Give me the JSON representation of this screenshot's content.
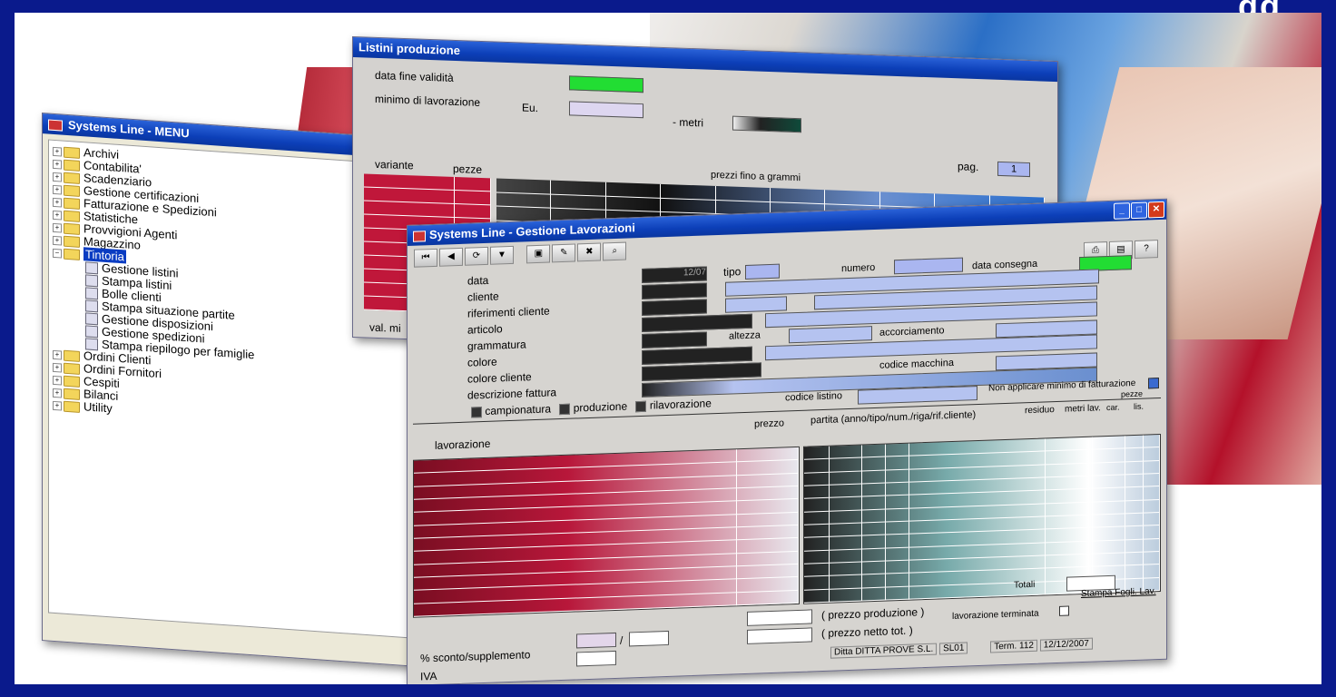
{
  "menu_window": {
    "title": "Systems Line - MENU",
    "items": [
      {
        "label": "Archivi",
        "expanded": false
      },
      {
        "label": "Contabilita'",
        "expanded": false
      },
      {
        "label": "Scadenziario",
        "expanded": false
      },
      {
        "label": "Gestione certificazioni",
        "expanded": false
      },
      {
        "label": "Fatturazione e Spedizioni",
        "expanded": false
      },
      {
        "label": "Statistiche",
        "expanded": false
      },
      {
        "label": "Provvigioni Agenti",
        "expanded": false
      },
      {
        "label": "Magazzino",
        "expanded": false
      },
      {
        "label": "Tintoria",
        "expanded": true,
        "selected": true
      }
    ],
    "sub_items": [
      "Gestione listini",
      "Stampa  listini",
      "Bolle   clienti",
      "Stampa   situazione partite",
      "Gestione disposizioni",
      "Gestione spedizioni",
      "Stampa   riepilogo per famiglie"
    ],
    "items_after": [
      "Ordini Clienti",
      "Ordini Fornitori",
      "Cespiti",
      "Bilanci",
      "Utility"
    ]
  },
  "listini_window": {
    "title": "Listini produzione",
    "data_fine_validita": "data fine validità",
    "minimo_lavorazione": "minimo di lavorazione",
    "eu_label": "Eu.",
    "metri_label": "- metri",
    "pag_label": "pag.",
    "pag_value": "1",
    "variante": "variante",
    "pezze": "pezze",
    "prezzi_header": "prezzi fino a grammi",
    "val_mi": "val. mi"
  },
  "gestione_window": {
    "title": "Systems Line - Gestione Lavorazioni",
    "fields": {
      "data": "data",
      "data_value": "12/07",
      "tipo": "tipo",
      "numero": "numero",
      "data_consegna": "data consegna",
      "cliente": "cliente",
      "riferimenti_cliente": "riferimenti cliente",
      "articolo": "articolo",
      "grammatura": "grammatura",
      "altezza": "altezza",
      "accorciamento": "accorciamento",
      "colore": "colore",
      "colore_cliente": "colore cliente",
      "codice_macchina": "codice macchina",
      "descrizione_fattura": "descrizione fattura"
    },
    "checks": {
      "campionatura": "campionatura",
      "produzione": "produzione",
      "rilavorazione": "rilavorazione",
      "codice_listino": "codice listino",
      "non_applicare": "Non applicare minimo di fatturazione"
    },
    "table_headers": {
      "lavorazione": "lavorazione",
      "prezzo": "prezzo",
      "partita": "partita (anno/tipo/num./riga/rif.cliente)",
      "residuo": "residuo",
      "metri_lav": "metri lav.",
      "pezze": "pezze",
      "car": "car.",
      "lis": "lis."
    },
    "footer": {
      "totali": "Totali",
      "prezzo_produzione": "( prezzo produzione )",
      "prezzo_netto": "( prezzo netto tot. )",
      "lavorazione_terminata": "lavorazione terminata",
      "stampa_fogli": "Stampa Fogli. Lav.",
      "sconto": "% sconto/supplemento",
      "slash": "/",
      "iva": "IVA",
      "ditta": "Ditta DITTA PROVE S.L.",
      "sl01": "SL01",
      "term": "Term. 112",
      "date": "12/12/2007"
    }
  },
  "brand_fragment": "gg"
}
